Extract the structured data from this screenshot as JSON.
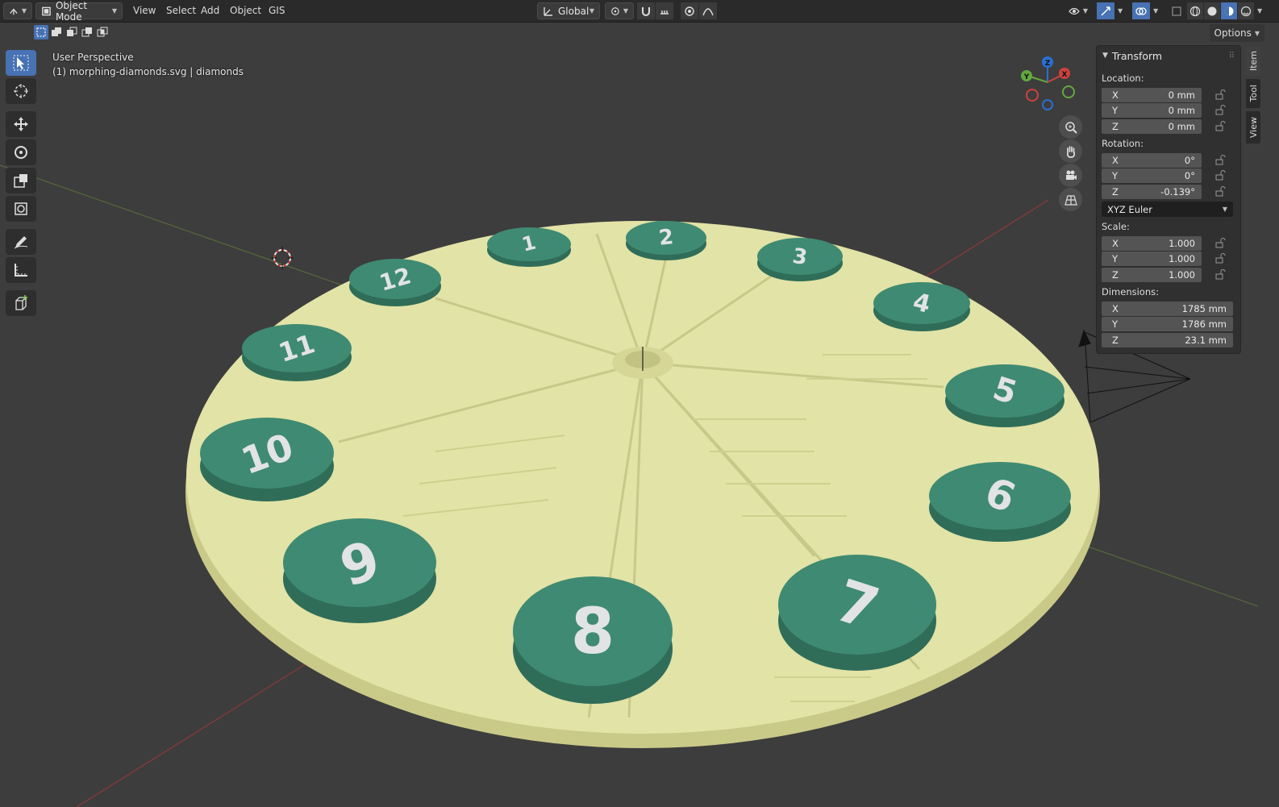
{
  "header": {
    "editor_type_icon": "3d-viewport-icon",
    "mode": "Object Mode",
    "menus": [
      "View",
      "Select",
      "Add",
      "Object",
      "GIS"
    ],
    "transform_orientation": "Global"
  },
  "options_label": "Options",
  "overlay": {
    "perspective": "User Perspective",
    "object_info": "(1) morphing-diamonds.svg | diamonds"
  },
  "gizmo": {
    "z": "Z",
    "y": "Y",
    "x": "X"
  },
  "clock_numbers": [
    "1",
    "2",
    "3",
    "4",
    "5",
    "6",
    "7",
    "8",
    "9",
    "10",
    "11",
    "12"
  ],
  "panel": {
    "title": "Transform",
    "location_label": "Location:",
    "location": [
      {
        "axis": "X",
        "value": "0 mm"
      },
      {
        "axis": "Y",
        "value": "0 mm"
      },
      {
        "axis": "Z",
        "value": "0 mm"
      }
    ],
    "rotation_label": "Rotation:",
    "rotation": [
      {
        "axis": "X",
        "value": "0°"
      },
      {
        "axis": "Y",
        "value": "0°"
      },
      {
        "axis": "Z",
        "value": "-0.139°"
      }
    ],
    "rotation_mode": "XYZ Euler",
    "scale_label": "Scale:",
    "scale": [
      {
        "axis": "X",
        "value": "1.000"
      },
      {
        "axis": "Y",
        "value": "1.000"
      },
      {
        "axis": "Z",
        "value": "1.000"
      }
    ],
    "dimensions_label": "Dimensions:",
    "dimensions": [
      {
        "axis": "X",
        "value": "1785 mm"
      },
      {
        "axis": "Y",
        "value": "1786 mm"
      },
      {
        "axis": "Z",
        "value": "23.1 mm"
      }
    ]
  },
  "side_tabs": [
    "Item",
    "Tool",
    "View"
  ],
  "colors": {
    "disc": "#e2e3a6",
    "disc_edge": "#c9ca88",
    "badge": "#3f8a72",
    "badge_edge": "#2f6d59",
    "digit": "#e1e3e4",
    "accent": "#4772b3"
  }
}
